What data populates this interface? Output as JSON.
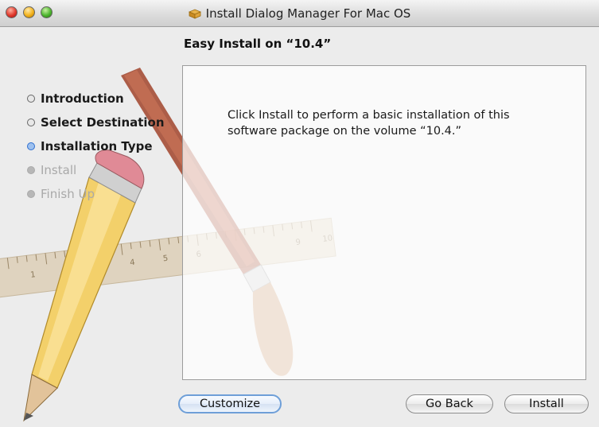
{
  "window": {
    "title": "Install Dialog Manager For Mac OS",
    "title_icon": "package-icon"
  },
  "heading": "Easy Install on “10.4”",
  "steps": [
    {
      "label": "Introduction",
      "state": "done"
    },
    {
      "label": "Select Destination",
      "state": "done"
    },
    {
      "label": "Installation Type",
      "state": "current"
    },
    {
      "label": "Install",
      "state": "todo"
    },
    {
      "label": "Finish Up",
      "state": "todo"
    }
  ],
  "content": {
    "text": "Click Install to perform a basic installation of this software package on the volume “10.4.”"
  },
  "buttons": {
    "customize": "Customize",
    "go_back": "Go Back",
    "install": "Install"
  },
  "ruler_numbers": [
    "1",
    "4",
    "5",
    "6",
    "9",
    "10"
  ],
  "colors": {
    "current_step_bullet": "#9ec1ef",
    "default_button_border": "#6e9fd8"
  }
}
